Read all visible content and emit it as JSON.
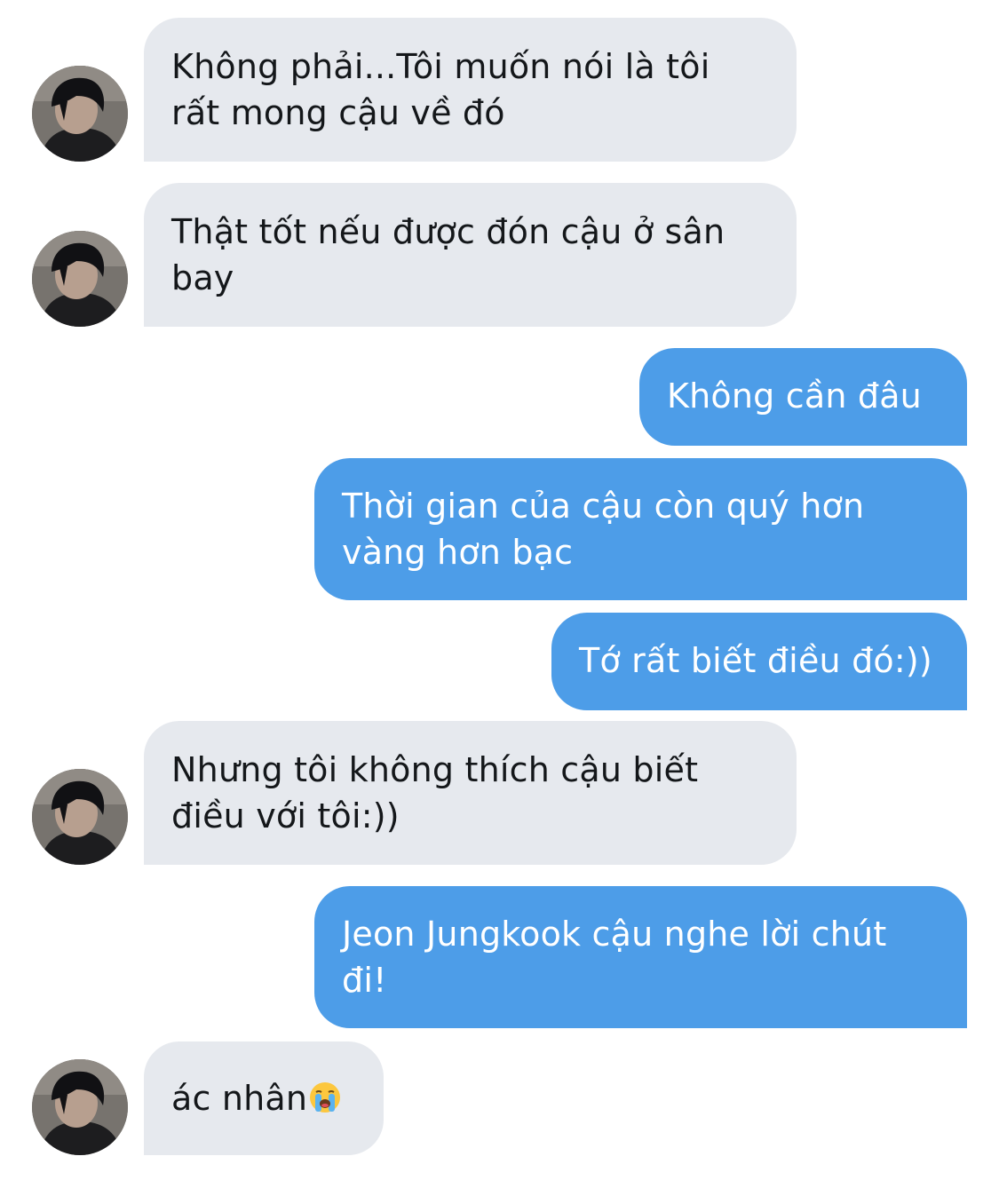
{
  "conversation": {
    "messages": [
      {
        "sender": "other",
        "lines": [
          "Không phải...Tôi muốn nói là tôi",
          "rất mong cậu về đó"
        ]
      },
      {
        "sender": "other",
        "lines": [
          "Thật tốt nếu được đón cậu ở sân",
          "bay"
        ]
      },
      {
        "sender": "me",
        "lines": [
          "Không cần đâu"
        ]
      },
      {
        "sender": "me",
        "lines": [
          "Thời gian của cậu còn quý hơn",
          "vàng hơn bạc"
        ]
      },
      {
        "sender": "me",
        "lines": [
          "Tớ rất biết điều đó:))"
        ]
      },
      {
        "sender": "other",
        "lines": [
          "Nhưng tôi không thích cậu biết",
          "điều với tôi:))"
        ]
      },
      {
        "sender": "me",
        "lines": [
          "Jeon Jungkook cậu nghe lời chút",
          "đi!"
        ]
      },
      {
        "sender": "other",
        "lines": [
          "ác nhân"
        ],
        "trailing_icon": "loudly-crying-face-emoji"
      }
    ]
  },
  "colors": {
    "incoming_bubble": "#e6e9ee",
    "incoming_text": "#14171a",
    "outgoing_bubble": "#4d9de8",
    "outgoing_text": "#ffffff",
    "background": "#ffffff"
  },
  "icons": {
    "avatar": "contact-avatar-photo",
    "emoji": "loudly-crying-face-emoji"
  }
}
